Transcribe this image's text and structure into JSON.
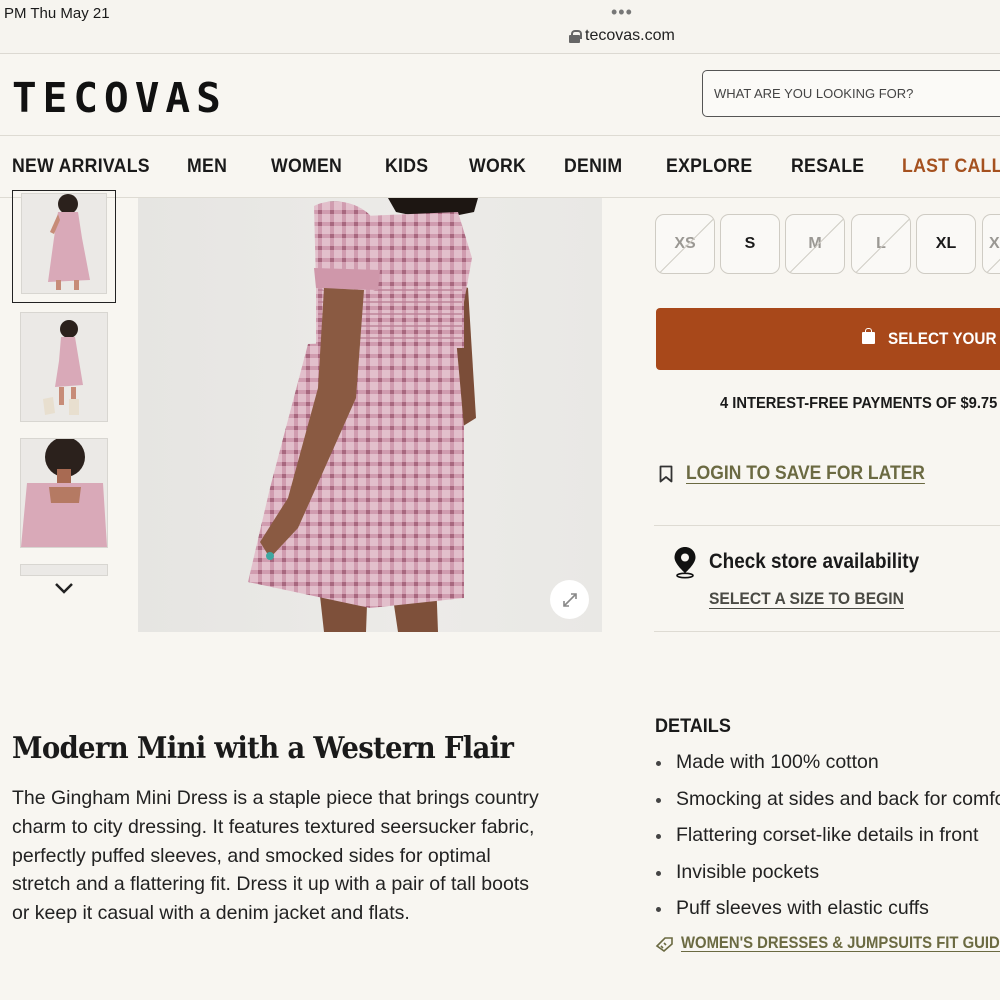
{
  "status_bar": {
    "time": "PM   Thu May 21",
    "dots": "•••",
    "url": "tecovas.com"
  },
  "header": {
    "logo": "TECOVAS",
    "search_placeholder": "WHAT ARE YOU LOOKING FOR?"
  },
  "nav": {
    "items": [
      "NEW ARRIVALS",
      "MEN",
      "WOMEN",
      "KIDS",
      "WORK",
      "DENIM",
      "EXPLORE",
      "RESALE",
      "LAST CALL"
    ]
  },
  "product": {
    "sizes": [
      {
        "label": "XS",
        "available": false
      },
      {
        "label": "S",
        "available": true
      },
      {
        "label": "M",
        "available": false
      },
      {
        "label": "L",
        "available": false
      },
      {
        "label": "XL",
        "available": true
      },
      {
        "label": "X",
        "available": false
      }
    ],
    "cta_label": "SELECT YOUR SIZE",
    "payments_text": "4 INTEREST-FREE PAYMENTS OF $9.75",
    "save_label": "LOGIN TO SAVE FOR LATER",
    "store_title": "Check store availability",
    "store_sub": "SELECT A SIZE TO BEGIN"
  },
  "description": {
    "title": "Modern Mini with a Western Flair",
    "lines": [
      "The Gingham Mini Dress is a staple piece that brings country",
      "charm to city dressing. It features textured seersucker fabric,",
      "perfectly puffed sleeves, and smocked sides for optimal",
      "stretch and a flattering fit. Dress it up with a pair of tall boots",
      "or keep it casual with a denim jacket and flats."
    ]
  },
  "details": {
    "heading": "DETAILS",
    "items": [
      "Made with 100% cotton",
      "Smocking at sides and back for comfort",
      "Flattering corset-like details in front",
      "Invisible pockets",
      "Puff sleeves with elastic cuffs"
    ],
    "fit_guide": "WOMEN'S DRESSES & JUMPSUITS FIT GUIDE"
  },
  "colors": {
    "background": "#f8f6f1",
    "accent": "#a8481a",
    "last_call": "#a5511f",
    "link": "#6b6a42",
    "dress": "#d9a9b8"
  },
  "icons": [
    "lock-icon",
    "bag-icon",
    "bookmark-icon",
    "location-pin-icon",
    "expand-icon",
    "chevron-down-icon",
    "ruler-tag-icon"
  ]
}
